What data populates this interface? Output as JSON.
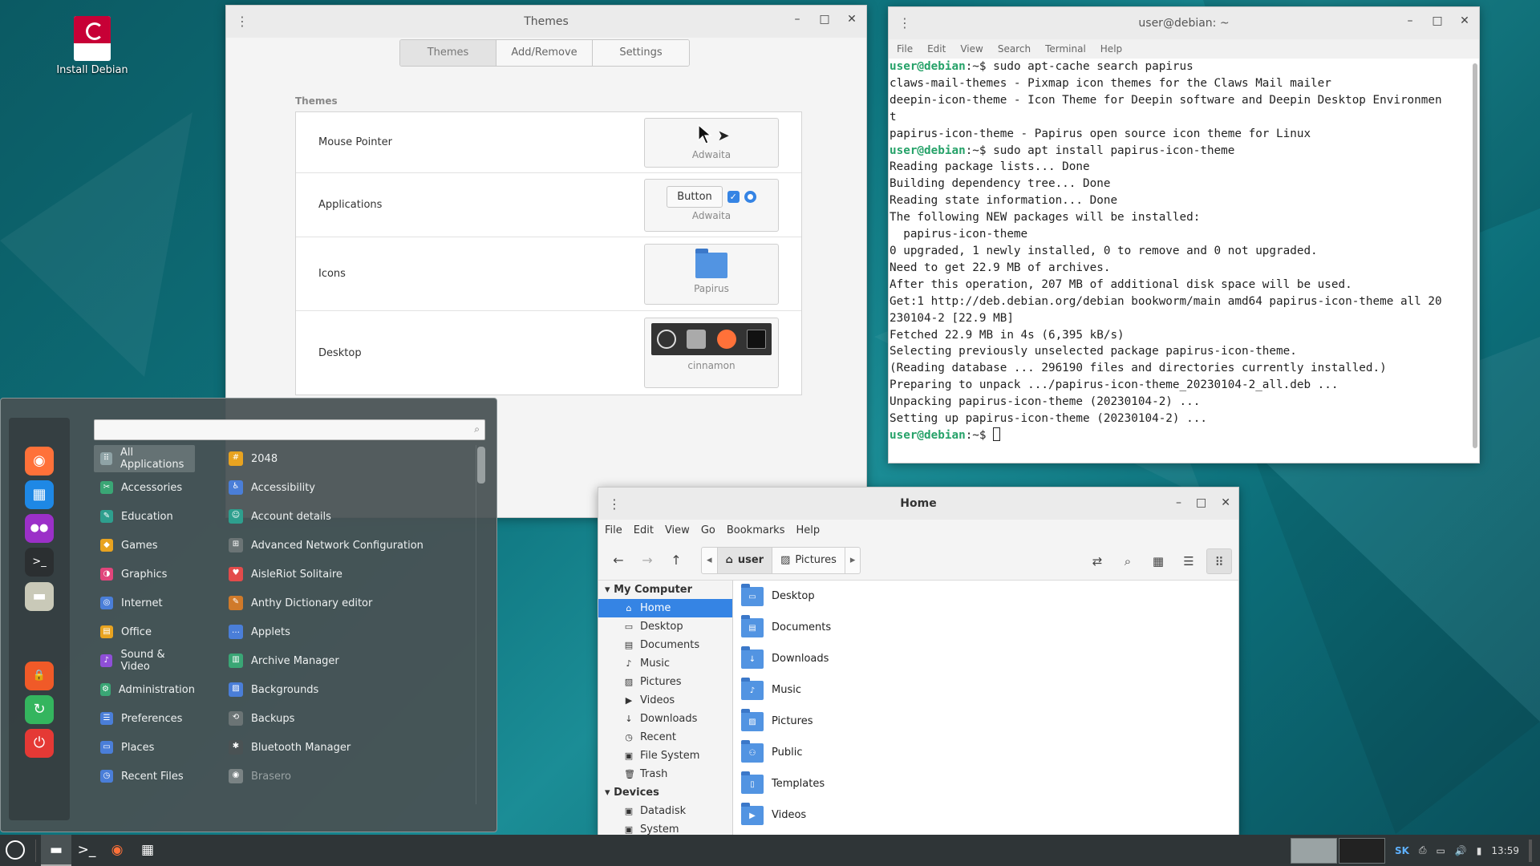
{
  "desktop": {
    "icon_label": "Install Debian"
  },
  "themes_window": {
    "title": "Themes",
    "tabs": [
      {
        "label": "Themes"
      },
      {
        "label": "Add/Remove"
      },
      {
        "label": "Settings"
      }
    ],
    "section_header": "Themes",
    "rows": [
      {
        "label": "Mouse Pointer",
        "value": "Adwaita"
      },
      {
        "label": "Applications",
        "value": "Adwaita",
        "demo_button": "Button"
      },
      {
        "label": "Icons",
        "value": "Papirus"
      },
      {
        "label": "Desktop",
        "value": "cinnamon"
      }
    ]
  },
  "terminal": {
    "title": "user@debian: ~",
    "menu": [
      "File",
      "Edit",
      "View",
      "Search",
      "Terminal",
      "Help"
    ],
    "lines": [
      {
        "prompt": "user@debian",
        "rest": ":~$ sudo apt-cache search papirus"
      },
      {
        "text": "claws-mail-themes - Pixmap icon themes for the Claws Mail mailer"
      },
      {
        "text": "deepin-icon-theme - Icon Theme for Deepin software and Deepin Desktop Environmen"
      },
      {
        "text": "t"
      },
      {
        "text": "papirus-icon-theme - Papirus open source icon theme for Linux"
      },
      {
        "prompt": "user@debian",
        "rest": ":~$ sudo apt install papirus-icon-theme"
      },
      {
        "text": "Reading package lists... Done"
      },
      {
        "text": "Building dependency tree... Done"
      },
      {
        "text": "Reading state information... Done"
      },
      {
        "text": "The following NEW packages will be installed:"
      },
      {
        "text": "  papirus-icon-theme"
      },
      {
        "text": "0 upgraded, 1 newly installed, 0 to remove and 0 not upgraded."
      },
      {
        "text": "Need to get 22.9 MB of archives."
      },
      {
        "text": "After this operation, 207 MB of additional disk space will be used."
      },
      {
        "text": "Get:1 http://deb.debian.org/debian bookworm/main amd64 papirus-icon-theme all 20"
      },
      {
        "text": "230104-2 [22.9 MB]"
      },
      {
        "text": "Fetched 22.9 MB in 4s (6,395 kB/s)"
      },
      {
        "text": "Selecting previously unselected package papirus-icon-theme."
      },
      {
        "text": "(Reading database ... 296190 files and directories currently installed.)"
      },
      {
        "text": "Preparing to unpack .../papirus-icon-theme_20230104-2_all.deb ..."
      },
      {
        "text": "Unpacking papirus-icon-theme (20230104-2) ..."
      },
      {
        "text": "Setting up papirus-icon-theme (20230104-2) ..."
      }
    ],
    "last_prompt": "user@debian",
    "last_prompt_rest": ":~$ "
  },
  "file_manager": {
    "title": "Home",
    "menu": [
      "File",
      "Edit",
      "View",
      "Go",
      "Bookmarks",
      "Help"
    ],
    "breadcrumb": [
      "user",
      "Pictures"
    ],
    "sidebar": {
      "my_computer_header": "My Computer",
      "my_computer_items": [
        {
          "label": "Home",
          "icon": "home-icon",
          "glyph": "⌂"
        },
        {
          "label": "Desktop",
          "icon": "desktop-icon",
          "glyph": "▭"
        },
        {
          "label": "Documents",
          "icon": "document-icon",
          "glyph": "▤"
        },
        {
          "label": "Music",
          "icon": "music-icon",
          "glyph": "♪"
        },
        {
          "label": "Pictures",
          "icon": "picture-icon",
          "glyph": "▨"
        },
        {
          "label": "Videos",
          "icon": "video-icon",
          "glyph": "▶"
        },
        {
          "label": "Downloads",
          "icon": "download-icon",
          "glyph": "↓"
        },
        {
          "label": "Recent",
          "icon": "clock-icon",
          "glyph": "◷"
        },
        {
          "label": "File System",
          "icon": "drive-icon",
          "glyph": "▣"
        },
        {
          "label": "Trash",
          "icon": "trash-icon",
          "glyph": "🗑"
        }
      ],
      "devices_header": "Devices",
      "devices_items": [
        {
          "label": "Datadisk",
          "icon": "drive-icon",
          "glyph": "▣"
        },
        {
          "label": "System",
          "icon": "drive-icon",
          "glyph": "▣"
        }
      ]
    },
    "items": [
      {
        "label": "Desktop",
        "icon": "folder-desktop-icon",
        "glyph": "▭"
      },
      {
        "label": "Documents",
        "icon": "folder-documents-icon",
        "glyph": "▤"
      },
      {
        "label": "Downloads",
        "icon": "folder-downloads-icon",
        "glyph": "↓"
      },
      {
        "label": "Music",
        "icon": "folder-music-icon",
        "glyph": "♪"
      },
      {
        "label": "Pictures",
        "icon": "folder-pictures-icon",
        "glyph": "▨"
      },
      {
        "label": "Public",
        "icon": "folder-public-icon",
        "glyph": "⚇"
      },
      {
        "label": "Templates",
        "icon": "folder-templates-icon",
        "glyph": "▯"
      },
      {
        "label": "Videos",
        "icon": "folder-videos-icon",
        "glyph": "▶"
      }
    ]
  },
  "menu": {
    "search_value": "",
    "categories": [
      {
        "label": "All Applications",
        "color": "#8fa3a6",
        "glyph": "⠿"
      },
      {
        "label": "Accessories",
        "color": "#3aa675",
        "glyph": "✂"
      },
      {
        "label": "Education",
        "color": "#2e9f8e",
        "glyph": "✎"
      },
      {
        "label": "Games",
        "color": "#e8a320",
        "glyph": "◆"
      },
      {
        "label": "Graphics",
        "color": "#e0457b",
        "glyph": "◑"
      },
      {
        "label": "Internet",
        "color": "#4a7ed8",
        "glyph": "◎"
      },
      {
        "label": "Office",
        "color": "#e8a320",
        "glyph": "▤"
      },
      {
        "label": "Sound & Video",
        "color": "#8f4fd8",
        "glyph": "♪"
      },
      {
        "label": "Administration",
        "color": "#3aa675",
        "glyph": "⚙"
      },
      {
        "label": "Preferences",
        "color": "#4a7ed8",
        "glyph": "☰"
      },
      {
        "label": "Places",
        "color": "#4a7ed8",
        "glyph": "▭"
      },
      {
        "label": "Recent Files",
        "color": "#4a7ed8",
        "glyph": "◷"
      }
    ],
    "apps": [
      {
        "label": "2048",
        "color": "#e8a320",
        "glyph": "#"
      },
      {
        "label": "Accessibility",
        "color": "#4a7ed8",
        "glyph": "♿"
      },
      {
        "label": "Account details",
        "color": "#2e9f8e",
        "glyph": "☺"
      },
      {
        "label": "Advanced Network Configuration",
        "color": "#6b7475",
        "glyph": "⊞"
      },
      {
        "label": "AisleRiot Solitaire",
        "color": "#e34b4b",
        "glyph": "♥"
      },
      {
        "label": "Anthy Dictionary editor",
        "color": "#d07a2a",
        "glyph": "✎"
      },
      {
        "label": "Applets",
        "color": "#4a7ed8",
        "glyph": "…"
      },
      {
        "label": "Archive Manager",
        "color": "#3aa675",
        "glyph": "▥"
      },
      {
        "label": "Backgrounds",
        "color": "#4a7ed8",
        "glyph": "▨"
      },
      {
        "label": "Backups",
        "color": "#6b7475",
        "glyph": "⟲"
      },
      {
        "label": "Bluetooth Manager",
        "color": "#4a5254",
        "glyph": "✱"
      },
      {
        "label": "Brasero",
        "color": "#7a8384",
        "glyph": "◉"
      }
    ],
    "favorites": [
      {
        "name": "firefox-icon",
        "color": "#ff7139",
        "glyph": "◉"
      },
      {
        "name": "software-manager-icon",
        "color": "#1e88e5",
        "glyph": "▦"
      },
      {
        "name": "settings-icon",
        "color": "#9b30c8",
        "glyph": "●●"
      },
      {
        "name": "terminal-icon",
        "color": "#2b2f31",
        "glyph": ">_"
      },
      {
        "name": "files-icon",
        "color": "#c9c9b8",
        "glyph": "▬"
      },
      {
        "name": "lock-icon",
        "color": "#f05a28",
        "glyph": "🔒"
      },
      {
        "name": "logout-icon",
        "color": "#34b55e",
        "glyph": "↻"
      },
      {
        "name": "power-icon",
        "color": "#e53935",
        "glyph": "⏻"
      }
    ]
  },
  "panel": {
    "keyboard_layout": "SK",
    "clock": "13:59"
  }
}
